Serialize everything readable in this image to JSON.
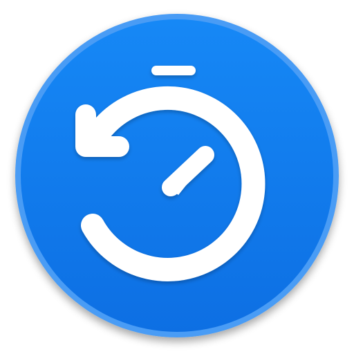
{
  "app_icon": {
    "icon_name": "stopwatch-reset-icon",
    "description_hint": "",
    "colors": {
      "ring": "#4a9cf5",
      "circle_top": "#1688f6",
      "circle_bottom": "#0d6fe3",
      "glyph": "#ffffff",
      "shadow": "#0a3f85"
    }
  }
}
